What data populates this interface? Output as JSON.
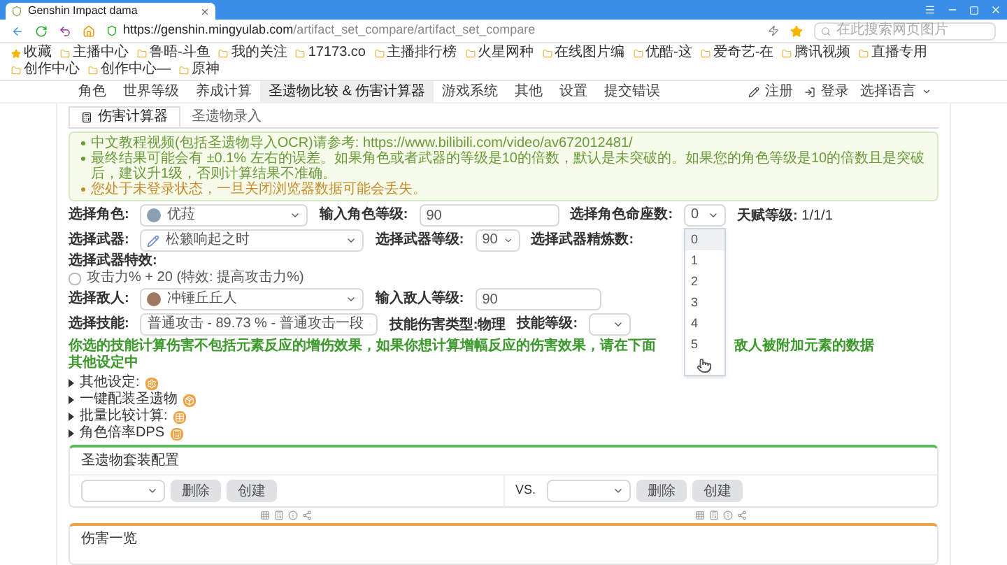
{
  "browser": {
    "tab_title": "Genshin Impact dama",
    "url_host": "https://genshin.mingyulab.com",
    "url_path": "/artifact_set_compare/artifact_set_compare",
    "search_placeholder": "在此搜索网页图片",
    "bookmarks": [
      "收藏",
      "主播中心",
      "鲁晤-斗鱼",
      "我的关注",
      "17173.co",
      "主播排行榜",
      "火星网种",
      "在线图片编",
      "优酷-这",
      "爱奇艺-在",
      "腾讯视频",
      "直播专用",
      "创作中心",
      "创作中心—",
      "原神"
    ]
  },
  "nav": {
    "items": [
      {
        "label": "角色",
        "selected": false
      },
      {
        "label": "世界等级",
        "selected": false
      },
      {
        "label": "养成计算",
        "selected": false
      },
      {
        "label": "圣遗物比较 & 伤害计算器",
        "selected": true
      },
      {
        "label": "游戏系统",
        "selected": false
      },
      {
        "label": "其他",
        "selected": false
      },
      {
        "label": "设置",
        "selected": false
      },
      {
        "label": "提交错误",
        "selected": false
      }
    ],
    "register": "注册",
    "login": "登录",
    "language": "选择语言"
  },
  "tabs": [
    {
      "label": "伤害计算器",
      "selected": true
    },
    {
      "label": "圣遗物录入",
      "selected": false
    }
  ],
  "notices": [
    {
      "kind": "info",
      "text": "中文教程视频(包括圣遗物导入OCR)请参考: https://www.bilibili.com/video/av672012481/"
    },
    {
      "kind": "info",
      "text": "最终结果可能会有 ±0.1% 左右的误差。如果角色或者武器的等级是10的倍数，默认是未突破的。如果您的角色等级是10的倍数且是突破后，建议升1级，否则计算结果不准确。"
    },
    {
      "kind": "warning",
      "text": "您处于未登录状态，一旦关闭浏览器数据可能会丢失。"
    }
  ],
  "character": {
    "label": "选择角色:",
    "value": "优菈",
    "level_label": "输入角色等级:",
    "level": "90",
    "constellation_label": "选择角色命座数:",
    "constellation": "0",
    "talent_label": "天赋等级:",
    "talent": "1/1/1"
  },
  "constellation_dropdown": {
    "expanded": true,
    "options": [
      {
        "label": "0",
        "selected": true
      },
      {
        "label": "1",
        "selected": false
      },
      {
        "label": "2",
        "selected": false
      },
      {
        "label": "3",
        "selected": false
      },
      {
        "label": "4",
        "selected": false
      },
      {
        "label": "5",
        "selected": false
      }
    ]
  },
  "weapon": {
    "label": "选择武器:",
    "value": "松籁响起之时",
    "level_label": "选择武器等级:",
    "level": "90",
    "refine_label": "选择武器精炼数:",
    "effect_label": "选择武器特效:",
    "effect": {
      "text": "攻击力% + 20 (特效: 提高攻击力%)",
      "checked": false
    }
  },
  "enemy": {
    "label": "选择敌人:",
    "value": "冲锤丘丘人",
    "level_label": "输入敌人等级:",
    "level": "90"
  },
  "skill": {
    "label": "选择技能:",
    "value": "普通攻击 - 89.73 % - 普通攻击一段",
    "type_label": "技能伤害类型:",
    "type": "物理",
    "level_label": "技能等级:"
  },
  "skill_note": [
    "你选的技能计算伤害不包括元素反应的增伤效果，如果你想计算增幅反应的伤害效果，请在下面其他设定中",
    "敌人被附加元素的数据"
  ],
  "sections": [
    "其他设定:",
    "一键配装圣遗物",
    "批量比较计算:",
    "角色倍率DPS"
  ],
  "artifact_panel": {
    "title": "圣遗物套装配置",
    "vs": "VS.",
    "sets": [
      {
        "delete": "删除",
        "create": "创建"
      },
      {
        "delete": "删除",
        "create": "创建"
      }
    ]
  },
  "damage_panel": {
    "title": "伤害一览"
  }
}
